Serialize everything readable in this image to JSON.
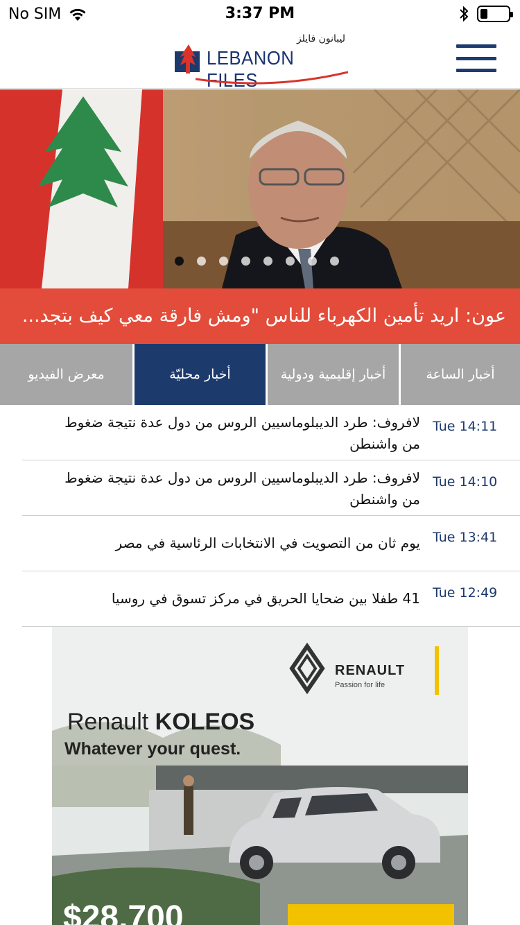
{
  "status_bar": {
    "carrier": "No SIM",
    "time": "3:37 PM"
  },
  "header": {
    "logo_arabic": "ليبانون فايلز",
    "logo_text": "LEBANON FILES"
  },
  "hero": {
    "slide_count": 8,
    "active_slide": 0
  },
  "headline": "عون: اريد تأمين الكهرباء للناس \"ومش فارقة معي كيف بتجد...",
  "tabs": [
    {
      "label": "معرض الفيديو",
      "active": false
    },
    {
      "label": "أخبار محليّة",
      "active": true
    },
    {
      "label": "أخبار إقليمية ودولية",
      "active": false
    },
    {
      "label": "أخبار الساعة",
      "active": false
    }
  ],
  "news": [
    {
      "time": "Tue 14:11",
      "title": "لافروف: طرد الديبلوماسيين الروس من دول عدة نتيجة ضغوط من واشنطن"
    },
    {
      "time": "Tue 14:10",
      "title": "لافروف: طرد الديبلوماسيين الروس من دول عدة نتيجة ضغوط من واشنطن"
    },
    {
      "time": "Tue 13:41",
      "title": "يوم ثان من التصويت في الانتخابات الرئاسية في مصر"
    },
    {
      "time": "Tue 12:49",
      "title": "41 طفلا بين ضحايا الحريق في مركز تسوق في روسيا"
    }
  ],
  "ad": {
    "brand": "RENAULT",
    "tagline": "Passion for life",
    "title_prefix": "Renault",
    "title_model": "KOLEOS",
    "subtitle": "Whatever your quest.",
    "price": "$28,700"
  },
  "colors": {
    "accent_red": "#e34c3a",
    "navy": "#1c3a6c",
    "tab_gray": "#a6a6a6"
  }
}
